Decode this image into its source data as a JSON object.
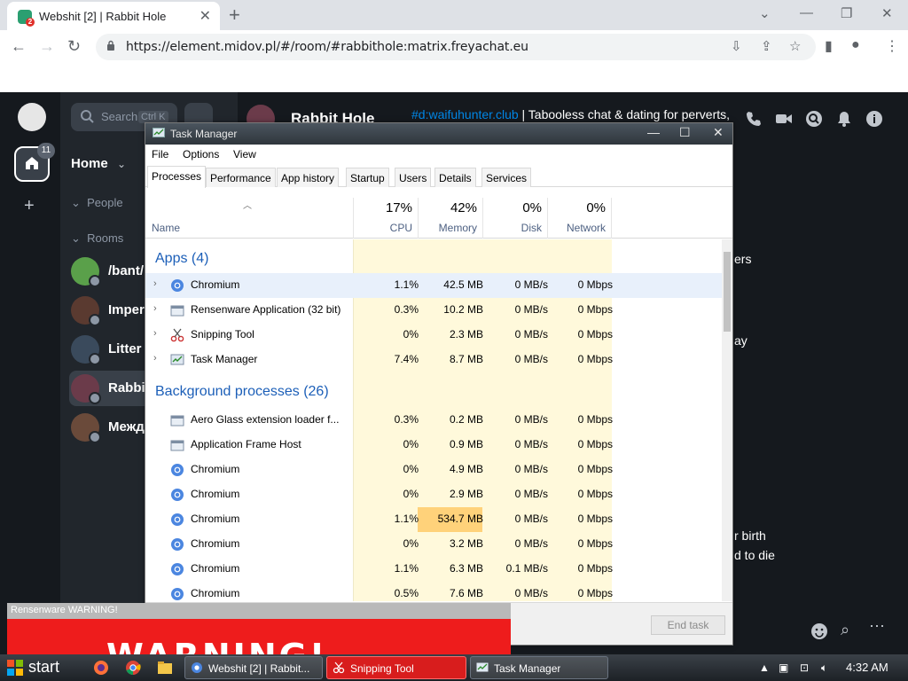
{
  "browser": {
    "tab_title": "Webshit [2] | Rabbit Hole",
    "new_tab": "+",
    "url": "https://element.midov.pl/#/room/#rabbithole:matrix.freyachat.eu",
    "window_controls": [
      "minimize-icon",
      "restore-icon",
      "close-icon"
    ]
  },
  "element": {
    "spaces_badge": "11",
    "search_placeholder": "Search",
    "search_shortcut": "Ctrl K",
    "home_label": "Home",
    "sections": {
      "people": "People",
      "rooms": "Rooms"
    },
    "rooms": [
      {
        "name": "/bant/",
        "avatar_color": "#5aa04a"
      },
      {
        "name": "Imper",
        "avatar_color": "#5a3a30"
      },
      {
        "name": "Litter",
        "avatar_color": "#3a4a5c"
      },
      {
        "name": "Rabbit",
        "avatar_color": "#6b3b4a",
        "active": true
      },
      {
        "name": "Межд",
        "avatar_color": "#6a4a3a"
      }
    ],
    "room_title": "Rabbit Hole",
    "room_topic_link": "#d:waifuhunter.club",
    "room_topic": " | Tabooless chat & dating for perverts,",
    "partial_messages": [
      "ers",
      "ay",
      "r birth",
      "d to die"
    ]
  },
  "task_manager": {
    "title": "Task Manager",
    "menu": [
      "File",
      "Options",
      "View"
    ],
    "tabs": [
      "Processes",
      "Performance",
      "App history",
      "Startup",
      "Users",
      "Details",
      "Services"
    ],
    "active_tab": "Processes",
    "columns": {
      "name": "Name",
      "cpu": {
        "pct": "17%",
        "label": "CPU"
      },
      "memory": {
        "pct": "42%",
        "label": "Memory"
      },
      "disk": {
        "pct": "0%",
        "label": "Disk"
      },
      "network": {
        "pct": "0%",
        "label": "Network"
      }
    },
    "groups": {
      "apps": "Apps (4)",
      "background": "Background processes (26)"
    },
    "apps": [
      {
        "name": "Chromium",
        "cpu": "1.1%",
        "mem": "42.5 MB",
        "disk": "0 MB/s",
        "net": "0 Mbps",
        "icon": "chromium-icon",
        "selected": true
      },
      {
        "name": "Rensenware Application (32 bit)",
        "cpu": "0.3%",
        "mem": "10.2 MB",
        "disk": "0 MB/s",
        "net": "0 Mbps",
        "icon": "app-window-icon"
      },
      {
        "name": "Snipping Tool",
        "cpu": "0%",
        "mem": "2.3 MB",
        "disk": "0 MB/s",
        "net": "0 Mbps",
        "icon": "scissors-icon"
      },
      {
        "name": "Task Manager",
        "cpu": "7.4%",
        "mem": "8.7 MB",
        "disk": "0 MB/s",
        "net": "0 Mbps",
        "icon": "task-manager-icon"
      }
    ],
    "background": [
      {
        "name": "Aero Glass extension loader f...",
        "cpu": "0.3%",
        "mem": "0.2 MB",
        "disk": "0 MB/s",
        "net": "0 Mbps",
        "icon": "app-window-icon"
      },
      {
        "name": "Application Frame Host",
        "cpu": "0%",
        "mem": "0.9 MB",
        "disk": "0 MB/s",
        "net": "0 Mbps",
        "icon": "app-window-icon"
      },
      {
        "name": "Chromium",
        "cpu": "0%",
        "mem": "4.9 MB",
        "disk": "0 MB/s",
        "net": "0 Mbps",
        "icon": "chromium-icon"
      },
      {
        "name": "Chromium",
        "cpu": "0%",
        "mem": "2.9 MB",
        "disk": "0 MB/s",
        "net": "0 Mbps",
        "icon": "chromium-icon"
      },
      {
        "name": "Chromium",
        "cpu": "1.1%",
        "mem": "534.7 MB",
        "disk": "0 MB/s",
        "net": "0 Mbps",
        "icon": "chromium-icon",
        "mem_hot": true
      },
      {
        "name": "Chromium",
        "cpu": "0%",
        "mem": "3.2 MB",
        "disk": "0 MB/s",
        "net": "0 Mbps",
        "icon": "chromium-icon"
      },
      {
        "name": "Chromium",
        "cpu": "1.1%",
        "mem": "6.3 MB",
        "disk": "0.1 MB/s",
        "net": "0 Mbps",
        "icon": "chromium-icon"
      },
      {
        "name": "Chromium",
        "cpu": "0.5%",
        "mem": "7.6 MB",
        "disk": "0 MB/s",
        "net": "0 Mbps",
        "icon": "chromium-icon"
      }
    ],
    "end_task": "End task"
  },
  "warning_window": {
    "title": "Rensenware WARNING!",
    "text": "WARNING!"
  },
  "taskbar": {
    "start": "start",
    "tasks": [
      {
        "label": "Webshit [2] | Rabbit...",
        "style": "dark"
      },
      {
        "label": "Snipping Tool",
        "style": "red"
      },
      {
        "label": "Task Manager",
        "style": "dark"
      }
    ],
    "clock": "4:32 AM"
  },
  "colors": {
    "element_bg": "#15191e",
    "element_sidebar": "#21262c",
    "tm_heat": "#fff9db",
    "tm_hot": "#ffd27a",
    "warning_red": "#ee1c1c",
    "link_blue": "#1c5fb8"
  }
}
